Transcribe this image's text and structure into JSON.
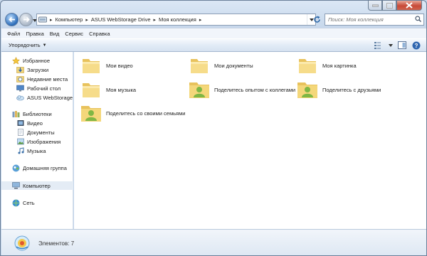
{
  "window": {
    "captions": {
      "minimize": "minimize",
      "maximize": "maximize",
      "close": "close"
    }
  },
  "address": {
    "crumbs": [
      "Компьютер",
      "ASUS WebStorage Drive",
      "Моя коллекция"
    ]
  },
  "search": {
    "placeholder": "Поиск: Моя коллекция"
  },
  "menu": {
    "items": [
      "Файл",
      "Правка",
      "Вид",
      "Сервис",
      "Справка"
    ]
  },
  "toolbar": {
    "organize_label": "Упорядочить"
  },
  "nav": {
    "favorites": {
      "label": "Избранное",
      "items": [
        "Загрузки",
        "Недавние места",
        "Рабочий стол",
        "ASUS WebStorage Drive"
      ]
    },
    "libraries": {
      "label": "Библиотеки",
      "items": [
        "Видео",
        "Документы",
        "Изображения",
        "Музыка"
      ]
    },
    "homegroup": {
      "label": "Домашняя группа"
    },
    "computer": {
      "label": "Компьютер"
    },
    "network": {
      "label": "Сеть"
    }
  },
  "items": [
    {
      "name": "Мои видео",
      "icon": "folder-icon"
    },
    {
      "name": "Мои документы",
      "icon": "folder-icon"
    },
    {
      "name": "Моя картинка",
      "icon": "folder-icon"
    },
    {
      "name": "Моя музыка",
      "icon": "folder-icon"
    },
    {
      "name": "Поделитесь опытом с коллегами",
      "icon": "shared-folder-icon"
    },
    {
      "name": "Поделитесь с друзьями",
      "icon": "shared-folder-icon"
    },
    {
      "name": "Поделитесь со своими семьями",
      "icon": "shared-folder-icon"
    }
  ],
  "status": {
    "count_text": "Элементов: 7"
  },
  "colors": {
    "selection": "#e4ecf5",
    "folder": "#f4d77a",
    "shared_person": "#7fb744"
  }
}
